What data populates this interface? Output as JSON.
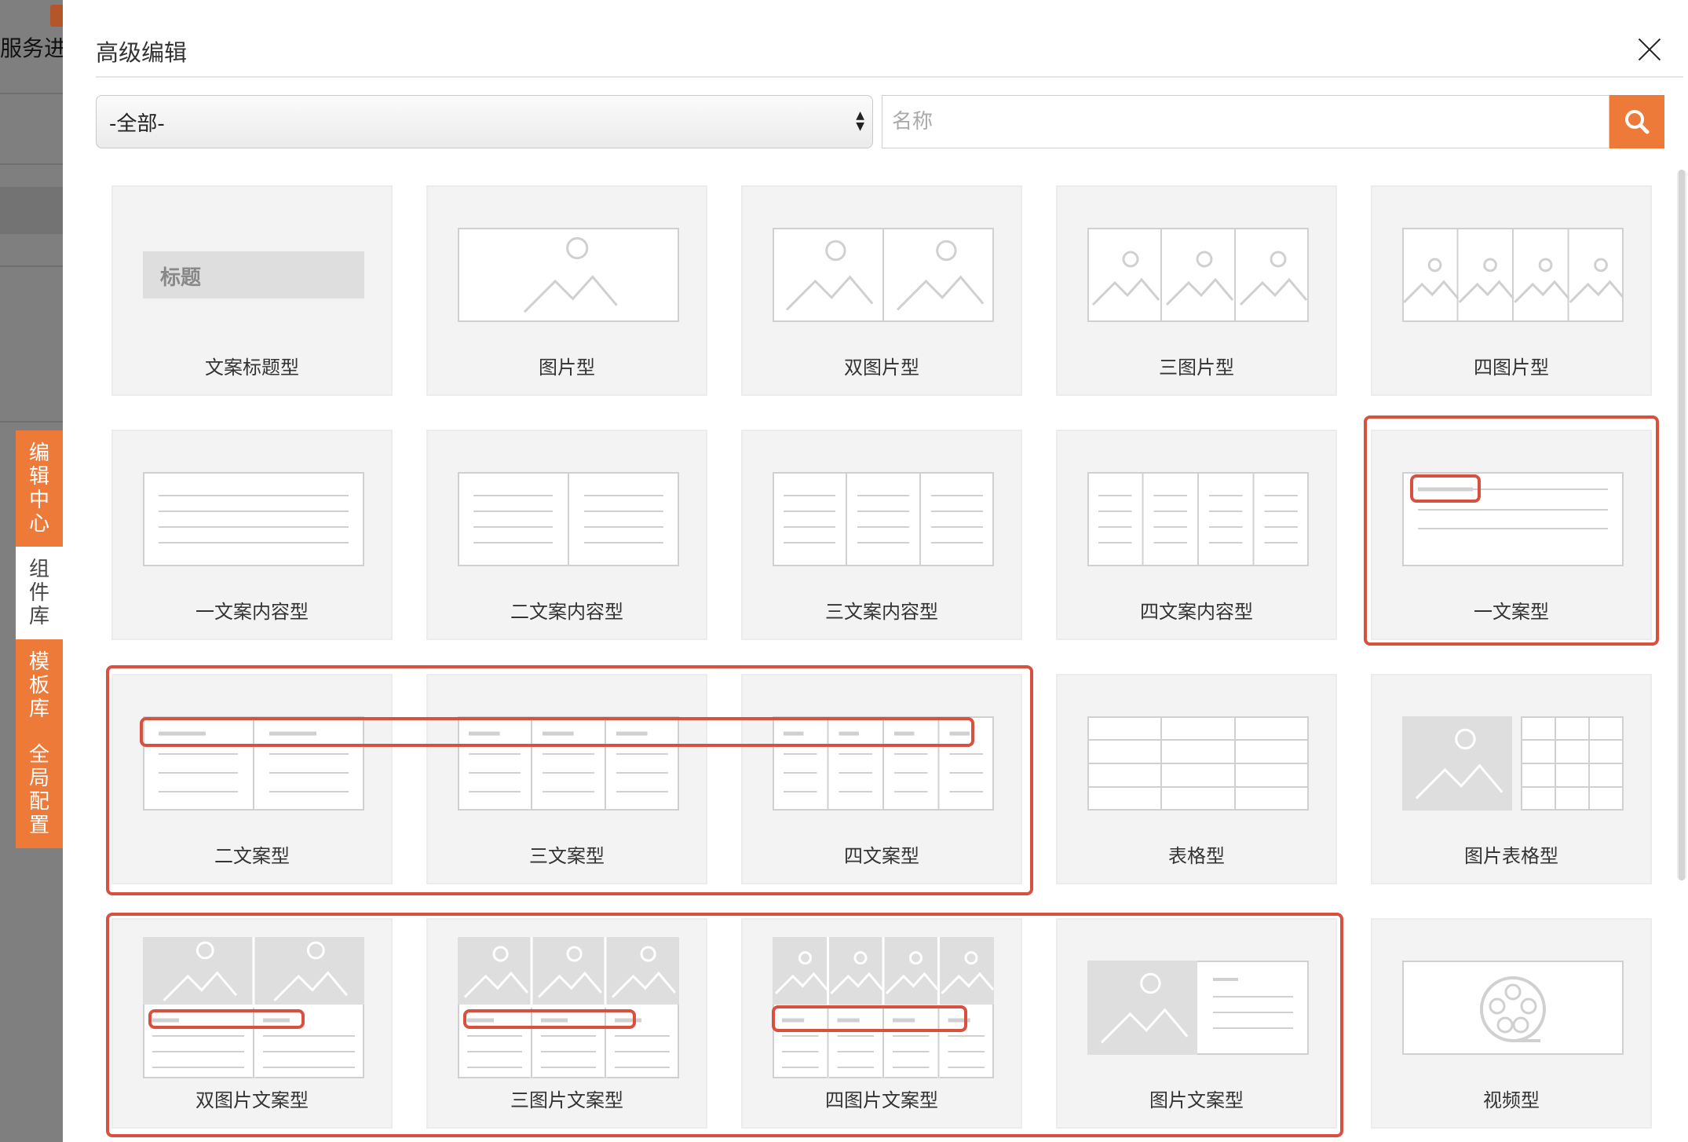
{
  "background": {
    "partial_title": "服务进",
    "side_tabs": [
      "编辑中心",
      "组件库",
      "模板库",
      "全局配置"
    ],
    "active_tab": 1
  },
  "modal": {
    "title": "高级编辑",
    "filter": {
      "selected": "-全部-"
    },
    "search": {
      "placeholder": "名称",
      "value": ""
    }
  },
  "components": [
    {
      "label": "文案标题型",
      "thumb": "title",
      "thumb_text": "标题"
    },
    {
      "label": "图片型",
      "thumb": "img1"
    },
    {
      "label": "双图片型",
      "thumb": "img2"
    },
    {
      "label": "三图片型",
      "thumb": "img3"
    },
    {
      "label": "四图片型",
      "thumb": "img4"
    },
    {
      "label": "一文案内容型",
      "thumb": "txt1"
    },
    {
      "label": "二文案内容型",
      "thumb": "txt2"
    },
    {
      "label": "三文案内容型",
      "thumb": "txt3"
    },
    {
      "label": "四文案内容型",
      "thumb": "txt4"
    },
    {
      "label": "一文案型",
      "thumb": "ctxt1"
    },
    {
      "label": "二文案型",
      "thumb": "ctxt2"
    },
    {
      "label": "三文案型",
      "thumb": "ctxt3"
    },
    {
      "label": "四文案型",
      "thumb": "ctxt4"
    },
    {
      "label": "表格型",
      "thumb": "table"
    },
    {
      "label": "图片表格型",
      "thumb": "imgtable"
    },
    {
      "label": "双图片文案型",
      "thumb": "imgtxt2"
    },
    {
      "label": "三图片文案型",
      "thumb": "imgtxt3"
    },
    {
      "label": "四图片文案型",
      "thumb": "imgtxt4"
    },
    {
      "label": "图片文案型",
      "thumb": "imgtxt"
    },
    {
      "label": "视频型",
      "thumb": "video"
    }
  ],
  "colors": {
    "accent": "#ee7a3a",
    "highlight": "#d9503f",
    "thumb_line": "#d0d0d0"
  }
}
